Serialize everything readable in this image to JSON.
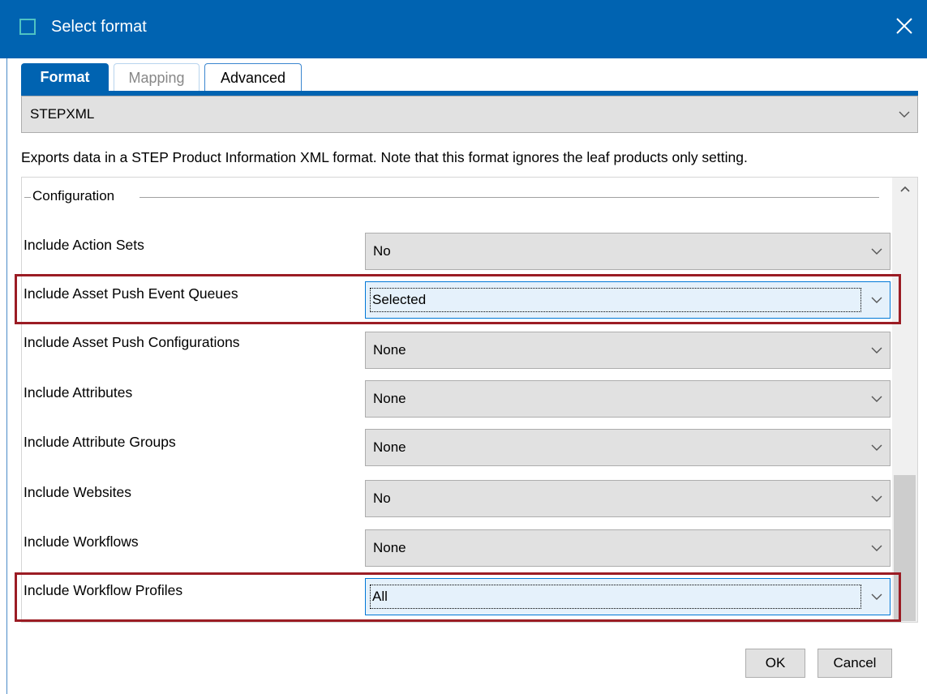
{
  "window": {
    "title": "Select format",
    "close_icon": "close-icon",
    "accent_color": "#0063b1"
  },
  "tabs": [
    {
      "label": "Format",
      "state": "active"
    },
    {
      "label": "Mapping",
      "state": "disabled"
    },
    {
      "label": "Advanced",
      "state": "normal"
    }
  ],
  "format_select": {
    "value": "STEPXML"
  },
  "description": "Exports data in a STEP Product Information XML format. Note that this format ignores the leaf products only setting.",
  "configuration": {
    "group_label": "Configuration",
    "rows": [
      {
        "label": "Include Action Sets",
        "value": "No"
      },
      {
        "label": "Include Asset Push Event Queues",
        "value": "Selected",
        "highlighted": true
      },
      {
        "label": "Include Asset Push Configurations",
        "value": "None"
      },
      {
        "label": "Include Attributes",
        "value": "None"
      },
      {
        "label": "Include Attribute Groups",
        "value": "None"
      },
      {
        "label": "Include Websites",
        "value": "No"
      },
      {
        "label": "Include Workflows",
        "value": "None"
      },
      {
        "label": "Include Workflow Profiles",
        "value": "All",
        "highlighted": true
      }
    ],
    "highlight_color": "#9b1c24"
  },
  "buttons": {
    "ok": "OK",
    "cancel": "Cancel"
  }
}
